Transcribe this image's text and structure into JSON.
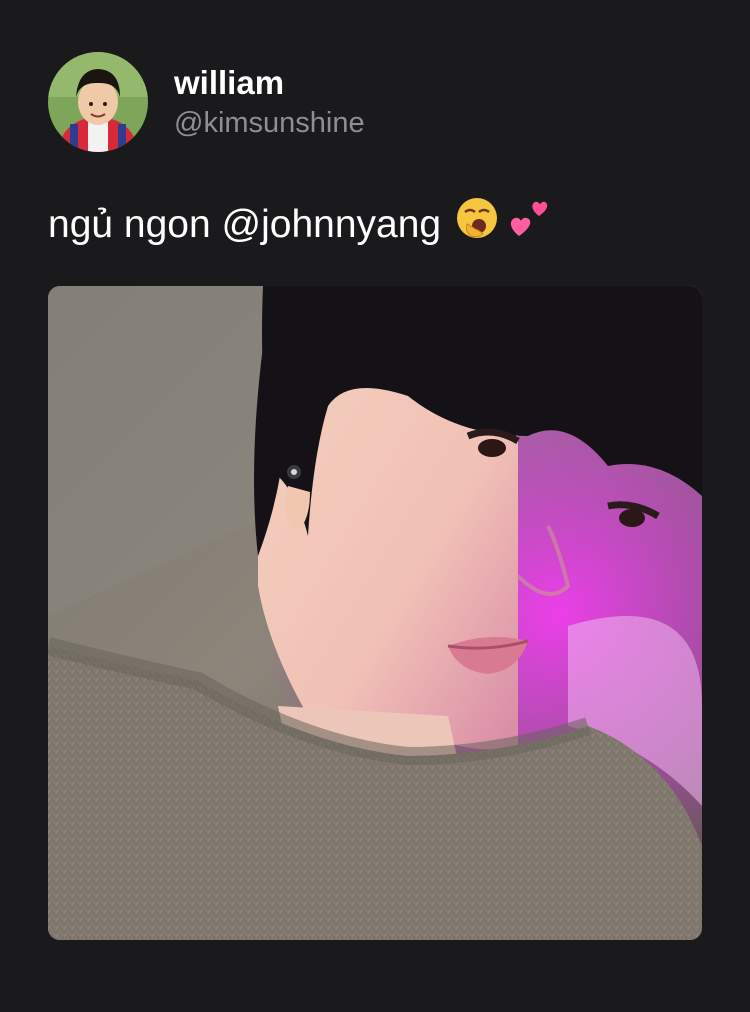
{
  "post": {
    "author": {
      "display_name": "william",
      "handle": "@kimsunshine",
      "avatar_icon": "profile-photo"
    },
    "text": "ngủ ngon @johnnyang",
    "emojis": [
      "yawning-face-emoji",
      "two-hearts-emoji"
    ],
    "image": {
      "description_icon": "selfie-photo"
    }
  },
  "colors": {
    "background": "#1a1a1c",
    "primary_text": "#ffffff",
    "secondary_text": "#8e8e93",
    "accent_light": "#e62ee8"
  }
}
